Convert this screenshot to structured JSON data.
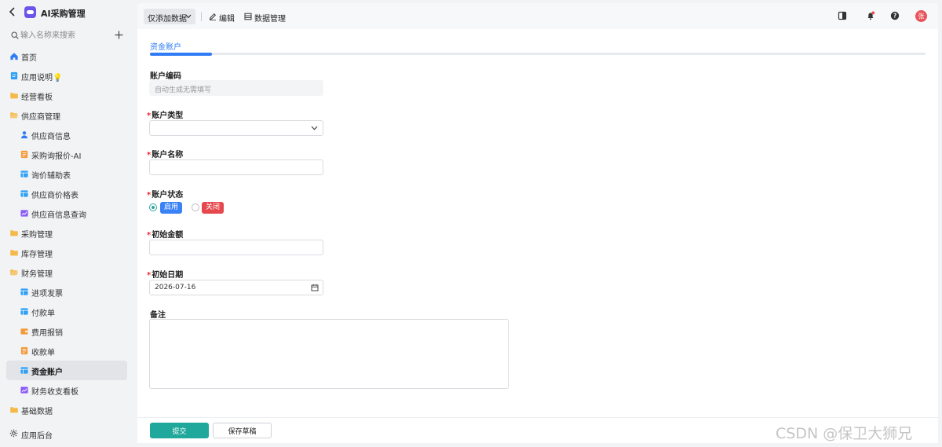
{
  "app": {
    "title": "AI采购管理"
  },
  "search": {
    "placeholder": "输入名称来搜索"
  },
  "nav": [
    {
      "label": "首页",
      "icon": "home-icon",
      "level": 0,
      "color": "#2f7bf5"
    },
    {
      "label": "应用说明💡",
      "icon": "doc-icon",
      "level": 0,
      "color": "#2f9ff5"
    },
    {
      "label": "经营看板",
      "icon": "folder-icon",
      "level": 0,
      "color": "#f5b94a"
    },
    {
      "label": "供应商管理",
      "icon": "folder-open-icon",
      "level": 0,
      "color": "#f5b94a"
    },
    {
      "label": "供应商信息",
      "icon": "user-icon",
      "level": 1,
      "color": "#2f7bf5"
    },
    {
      "label": "采购询报价-AI",
      "icon": "form-icon",
      "level": 1,
      "color": "#f39a3b"
    },
    {
      "label": "询价辅助表",
      "icon": "table-icon",
      "level": 1,
      "color": "#2f9ff5"
    },
    {
      "label": "供应商价格表",
      "icon": "table-icon",
      "level": 1,
      "color": "#2f9ff5"
    },
    {
      "label": "供应商信息查询",
      "icon": "chart-icon",
      "level": 1,
      "color": "#8b5cf6"
    },
    {
      "label": "采购管理",
      "icon": "folder-icon",
      "level": 0,
      "color": "#f5b94a"
    },
    {
      "label": "库存管理",
      "icon": "folder-icon",
      "level": 0,
      "color": "#f5b94a"
    },
    {
      "label": "财务管理",
      "icon": "folder-open-icon",
      "level": 0,
      "color": "#f5b94a"
    },
    {
      "label": "进项发票",
      "icon": "table-icon",
      "level": 1,
      "color": "#2f9ff5"
    },
    {
      "label": "付款单",
      "icon": "table-icon",
      "level": 1,
      "color": "#2f9ff5"
    },
    {
      "label": "费用报销",
      "icon": "wallet-icon",
      "level": 1,
      "color": "#f39a3b"
    },
    {
      "label": "收款单",
      "icon": "form-icon",
      "level": 1,
      "color": "#f39a3b"
    },
    {
      "label": "资金账户",
      "icon": "table-icon",
      "level": 1,
      "color": "#2f9ff5",
      "active": true
    },
    {
      "label": "财务收支看板",
      "icon": "chart-icon",
      "level": 1,
      "color": "#8b5cf6"
    },
    {
      "label": "基础数据",
      "icon": "folder-icon",
      "level": 0,
      "color": "#f5b94a"
    }
  ],
  "bottom": {
    "label": "应用后台",
    "icon": "gear-icon"
  },
  "toolbar": {
    "mode_label": "仅添加数据",
    "edit_label": "编辑",
    "data_label": "数据管理",
    "avatar_text": "张"
  },
  "form": {
    "tab_label": "资金账户",
    "progress": 0.08,
    "required_mark": "*",
    "fields": {
      "code_label": "账户编码",
      "code_placeholder": "自动生成无需填写",
      "type_label": "账户类型",
      "type_value": "",
      "name_label": "账户名称",
      "name_value": "",
      "status_label": "账户状态",
      "status_options": [
        {
          "label": "启用",
          "color": "#3b82f6",
          "checked": true
        },
        {
          "label": "关闭",
          "color": "#e5484d",
          "checked": false
        }
      ],
      "amount_label": "初始金额",
      "amount_value": "",
      "date_label": "初始日期",
      "date_value": "2026-07-16",
      "note_label": "备注",
      "note_value": ""
    }
  },
  "footer": {
    "submit_label": "提交",
    "draft_label": "保存草稿"
  },
  "watermark": "CSDN @保卫大狮兄"
}
